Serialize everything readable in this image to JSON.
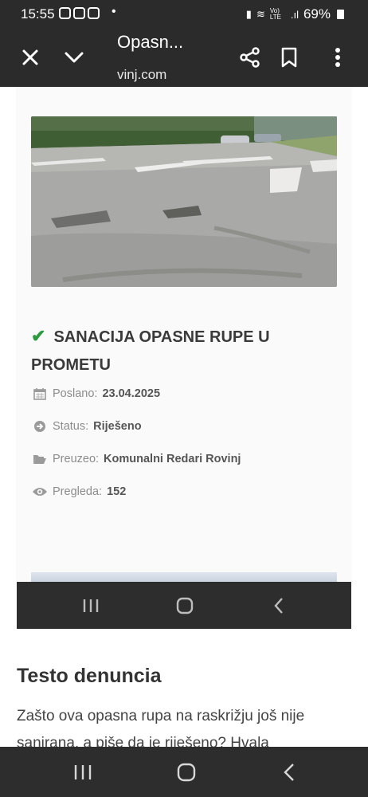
{
  "status_bar": {
    "time": "15:55",
    "volte": "Vo) LTE",
    "battery": "69%"
  },
  "toolbar": {
    "title": "Opasn...",
    "url": "vinj.com"
  },
  "report": {
    "title_line1": "SANACIJA OPASNE RUPE U",
    "title_line2": "PROMETU",
    "sent_label": "Poslano:",
    "sent_value": "23.04.2025",
    "status_label": "Status:",
    "status_value": "Riješeno",
    "taken_label": "Preuzeo:",
    "taken_value": "Komunalni Redari Rovinj",
    "views_label": "Pregleda:",
    "views_value": "152"
  },
  "section": {
    "title": "Testo denuncia",
    "text_line1": "Zašto ova opasna rupa na raskrižju još nije",
    "text_line2": "sanirana, a piše da je riješeno? Hvala"
  },
  "colors": {
    "bar_bg": "#2b2b2b",
    "check_green": "#2e9a3f"
  },
  "icons": [
    "close-icon",
    "chevron-down-icon",
    "share-icon",
    "bookmark-icon",
    "more-vert-icon",
    "calendar-icon",
    "arrow-circle-icon",
    "folder-open-icon",
    "eye-icon",
    "recents-icon",
    "home-icon",
    "back-icon"
  ]
}
